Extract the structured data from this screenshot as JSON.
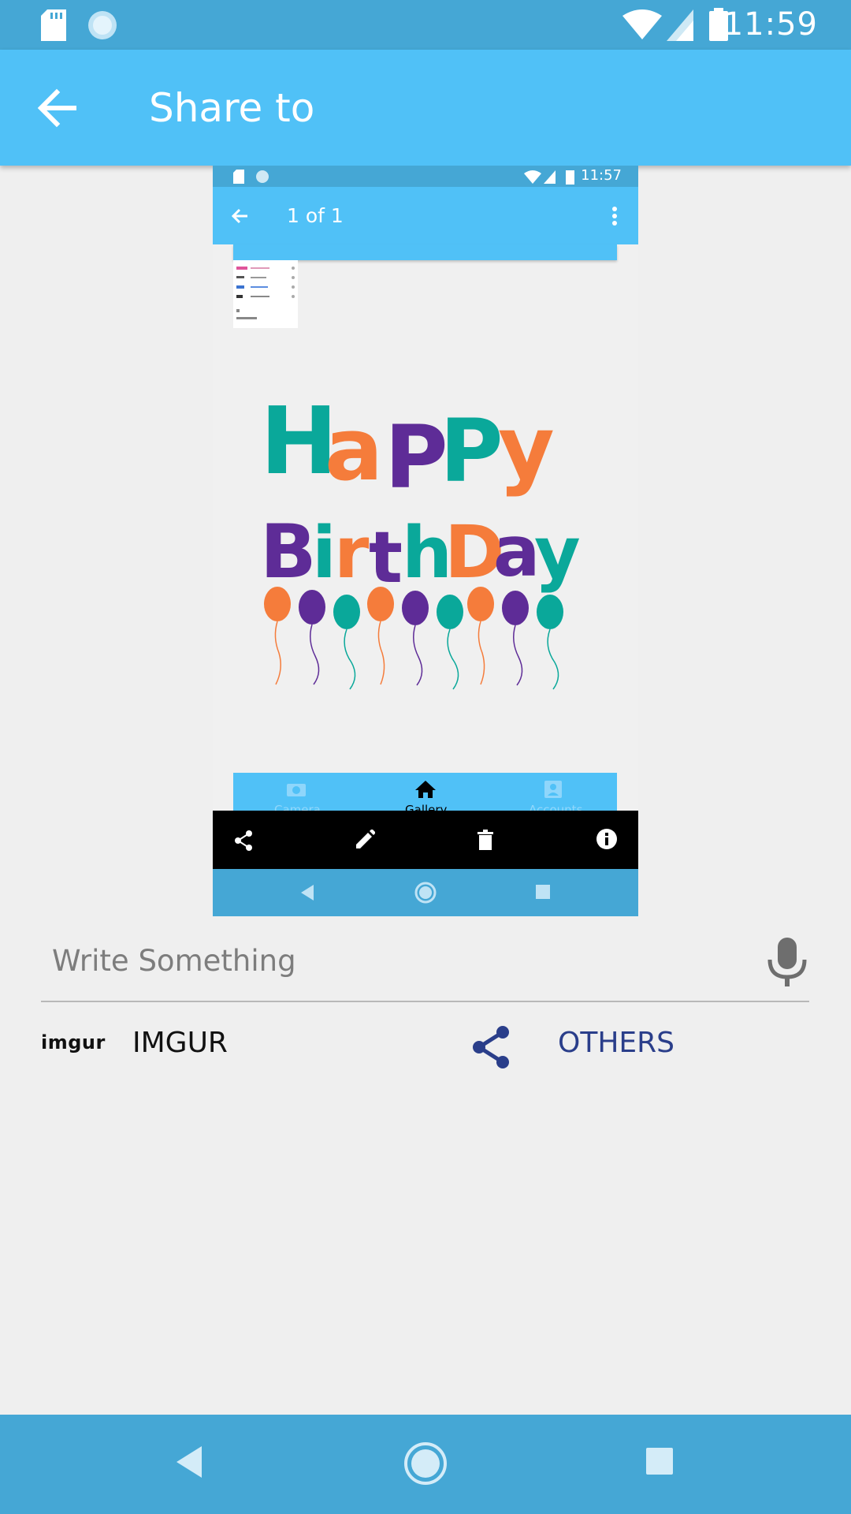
{
  "status_bar": {
    "time": "11:59"
  },
  "app_bar": {
    "title": "Share to",
    "back_icon": "arrow-back-icon"
  },
  "preview": {
    "status_time": "11:57",
    "title": "1 of 1",
    "image_text": {
      "line1": "HAPPY",
      "line2": "BirthDay"
    },
    "bottom_nav": [
      "Camera",
      "Gallery",
      "Accounts"
    ],
    "actions": [
      "share-icon",
      "edit-icon",
      "delete-icon",
      "info-icon"
    ],
    "colors": {
      "teal": "#0aa89a",
      "orange": "#f57c3b",
      "purple": "#5e2c97"
    }
  },
  "caption": {
    "placeholder": "Write Something",
    "value": ""
  },
  "targets": {
    "imgur": {
      "logo": "imgur",
      "label": "IMGUR"
    },
    "others": {
      "label": "OTHERS"
    }
  },
  "colors": {
    "status": "#45a7d5",
    "appbar": "#50c1f7",
    "others": "#2a3e8a"
  }
}
